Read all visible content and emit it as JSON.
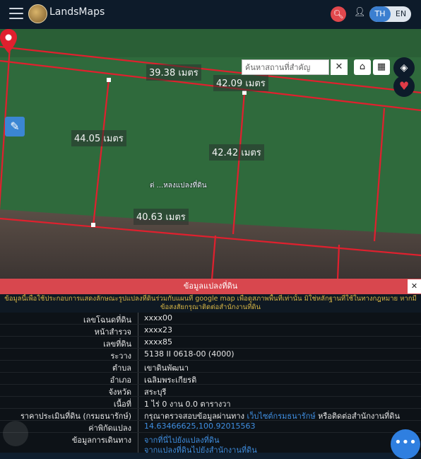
{
  "app": {
    "title": "LandsMaps"
  },
  "lang": {
    "th": "TH",
    "en": "EN"
  },
  "map": {
    "search_placeholder": "ค้นหาสถานที่สำคัญ",
    "marker_label": "ต่ ...หลงแปลงที่ดิน",
    "distances": [
      "39.38 เมตร",
      "42.09 เมตร",
      "44.05 เมตร",
      "42.42 เมตร",
      "40.63 เมตร"
    ],
    "colors": {
      "boundary": "#e0202e",
      "field": "#2f6a3c"
    }
  },
  "panel": {
    "title": "ข้อมูลแปลงที่ดิน",
    "notice": "ข้อมูลนี้เพื่อใช้ประกอบการแสดงลักษณะรูปแปลงที่ดินร่วมกับแผนที่ google map เพื่อดูสภาพพื้นที่เท่านั้น มิใช่หลักฐานที่ใช้ในทางกฎหมาย หากมีข้อสงสัยกรุณาติดต่อสำนักงานที่ดิน",
    "rows": [
      {
        "key": "เลขโฉนดที่ดิน",
        "value": "xxxx00"
      },
      {
        "key": "หน้าสำรวจ",
        "value": "xxxx23"
      },
      {
        "key": "เลขที่ดิน",
        "value": "xxxx85"
      },
      {
        "key": "ระวาง",
        "value": "5138 II 0618-00 (4000)"
      },
      {
        "key": "ตำบล",
        "value": "เขาดินพัฒนา"
      },
      {
        "key": "อำเภอ",
        "value": "เฉลิมพระเกียรติ"
      },
      {
        "key": "จังหวัด",
        "value": "สระบุรี"
      },
      {
        "key": "เนื้อที่",
        "value": "1 ไร่ 0 งาน 0.0 ตารางวา"
      }
    ],
    "price": {
      "key": "ราคาประเมินที่ดิน (กรมธนารักษ์)",
      "prefix": "กรุณาตรวจสอบข้อมูลผ่านทาง",
      "link": "เว็บไซต์กรมธนารักษ์",
      "suffix": "หรือติดต่อสำนักงานที่ดิน"
    },
    "coords": {
      "key": "ค่าพิกัดแปลง",
      "value": "14.63466625,100.92015563"
    },
    "travel": {
      "key": "ข้อมูลการเดินทาง",
      "link1": "จากที่นี่ไปยังแปลงที่ดิน",
      "link2": "จากแปลงที่ดินไปยังสำนักงานที่ดิน"
    }
  },
  "fab": {
    "label": "•••"
  }
}
